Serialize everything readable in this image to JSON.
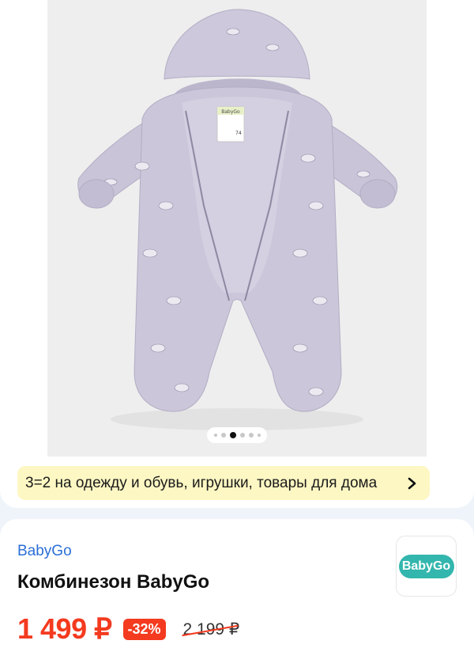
{
  "gallery": {
    "photo_alt": "Комбинезон BabyGo",
    "tag_text": "BabyGo",
    "tag_size": "74",
    "dots_total": 6,
    "dots_active_index": 2
  },
  "promo": {
    "text": "3=2 на одежду и обувь, игрушки, товары для дома",
    "icon": "chevron-right-icon"
  },
  "product": {
    "brand": "BabyGo",
    "title": "Комбинезон BabyGo",
    "price": "1 499 ₽",
    "discount": "-32%",
    "old_price": "2 199 ₽",
    "logo_text": "BabyGo"
  },
  "colors": {
    "accent_price": "#f43a1f",
    "brand_link": "#2b6fd6",
    "promo_bg": "#fdf7c3",
    "logo_bg": "#33b6ad",
    "garment": "#cbc6d9"
  }
}
